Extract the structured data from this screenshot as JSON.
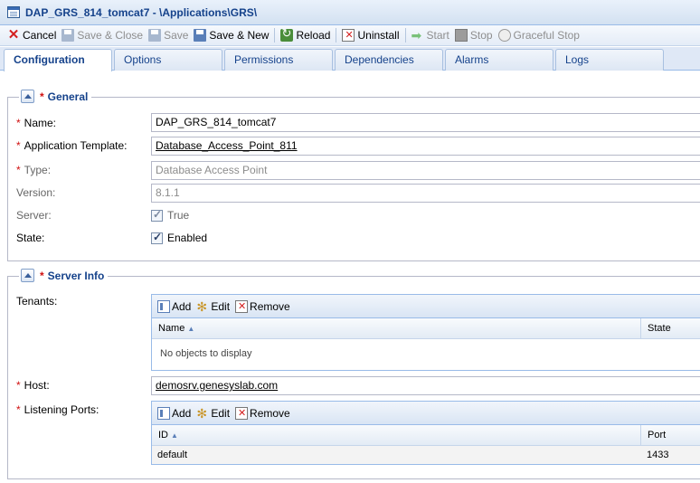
{
  "window": {
    "title": "DAP_GRS_814_tomcat7 - \\Applications\\GRS\\"
  },
  "toolbar": {
    "cancel": "Cancel",
    "save_close": "Save & Close",
    "save": "Save",
    "save_new": "Save & New",
    "reload": "Reload",
    "uninstall": "Uninstall",
    "start": "Start",
    "stop": "Stop",
    "graceful_stop": "Graceful Stop"
  },
  "tabs": [
    "Configuration",
    "Options",
    "Permissions",
    "Dependencies",
    "Alarms",
    "Logs"
  ],
  "general": {
    "legend": "General",
    "name_label": "Name:",
    "name_value": "DAP_GRS_814_tomcat7",
    "template_label": "Application Template:",
    "template_value": "Database_Access_Point_811",
    "type_label": "Type:",
    "type_value": "Database Access Point",
    "version_label": "Version:",
    "version_value": "8.1.1",
    "server_label": "Server:",
    "server_value": "True",
    "state_label": "State:",
    "state_value": "Enabled"
  },
  "server_info": {
    "legend": "Server Info",
    "tenants_label": "Tenants:",
    "grid_add": "Add",
    "grid_edit": "Edit",
    "grid_remove": "Remove",
    "tenants_col_name": "Name",
    "tenants_col_state": "State",
    "tenants_empty": "No objects to display",
    "host_label": "Host:",
    "host_value": "demosrv.genesyslab.com",
    "ports_label": "Listening Ports:",
    "ports_col_id": "ID",
    "ports_col_port": "Port",
    "ports_rows": [
      {
        "id": "default",
        "port": "1433"
      }
    ]
  },
  "colors": {
    "accent": "#15428b",
    "required": "#d01010",
    "border": "#99bbe8"
  }
}
